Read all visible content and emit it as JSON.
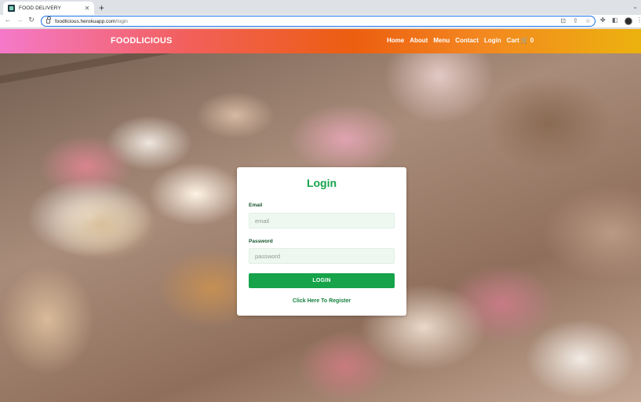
{
  "browser": {
    "tab_title": "FOOD DELIVERY",
    "url_host": "foodlicious.herokuapp.com",
    "url_path": "/login",
    "icons": [
      "back-icon",
      "forward-icon",
      "reload-icon",
      "lock-icon",
      "install-icon",
      "share-icon",
      "star-icon",
      "extensions-icon",
      "side-panel-icon",
      "profile-avatar",
      "menu-icon"
    ]
  },
  "navbar": {
    "brand": "FOODLICIOUS",
    "links": [
      "Home",
      "About",
      "Menu",
      "Contact",
      "Login"
    ],
    "cart_label": "Cart",
    "cart_count": "0"
  },
  "login": {
    "title": "Login",
    "email_label": "Email",
    "email_placeholder": "email",
    "email_value": "",
    "password_label": "Password",
    "password_placeholder": "password",
    "password_value": "",
    "submit_label": "LOGIN",
    "register_link": "Click Here To Register"
  },
  "colors": {
    "accent_green": "#16a34a",
    "navbar_gradient": [
      "#f479c9",
      "#ec5e10",
      "#ecb20e"
    ]
  }
}
